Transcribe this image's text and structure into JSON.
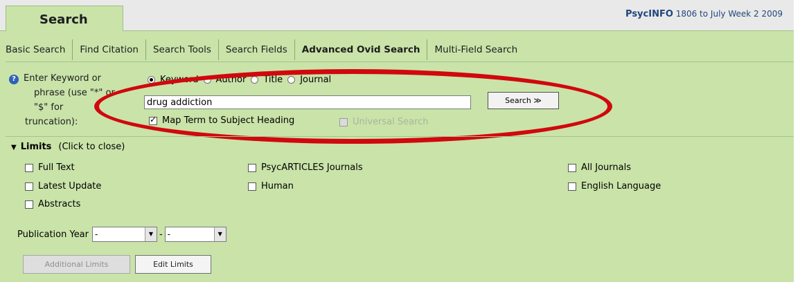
{
  "header": {
    "search_tab": "Search",
    "db_name": "PsycINFO",
    "db_range": " 1806 to July Week 2 2009"
  },
  "tabs": [
    "Basic Search",
    "Find Citation",
    "Search Tools",
    "Search Fields",
    "Advanced Ovid Search",
    "Multi-Field Search"
  ],
  "active_tab": "Advanced Ovid Search",
  "query": {
    "help_icon": "question-mark-icon",
    "prompt_lines": [
      "Enter Keyword or",
      "phrase (use \"*\" or",
      "\"$\" for",
      "truncation):"
    ],
    "radios": [
      {
        "label": "Keyword",
        "checked": true
      },
      {
        "label": "Author",
        "checked": false
      },
      {
        "label": "Title",
        "checked": false
      },
      {
        "label": "Journal",
        "checked": false
      }
    ],
    "input_value": "drug addiction",
    "search_button": "Search ≫",
    "map_term_label": "Map Term to Subject Heading",
    "map_term_checked": true,
    "universal_label": "Universal Search",
    "universal_enabled": false,
    "highlight_color": "#d1080d"
  },
  "limits": {
    "title": "Limits",
    "toggle_hint": "(Click to close)",
    "col1": [
      "Full Text",
      "Latest Update",
      "Abstracts"
    ],
    "col2": [
      "PsycARTICLES Journals",
      "Human"
    ],
    "col3": [
      "All Journals",
      "English Language"
    ],
    "pub_year_label": "Publication Year",
    "year_from": "-",
    "year_to": "-",
    "additional_limits_button": "Additional Limits",
    "edit_limits_button": "Edit Limits"
  },
  "colors": {
    "panel_green": "#c9e3a9",
    "header_grey": "#e9e9e9",
    "db_blue": "#20467c"
  }
}
